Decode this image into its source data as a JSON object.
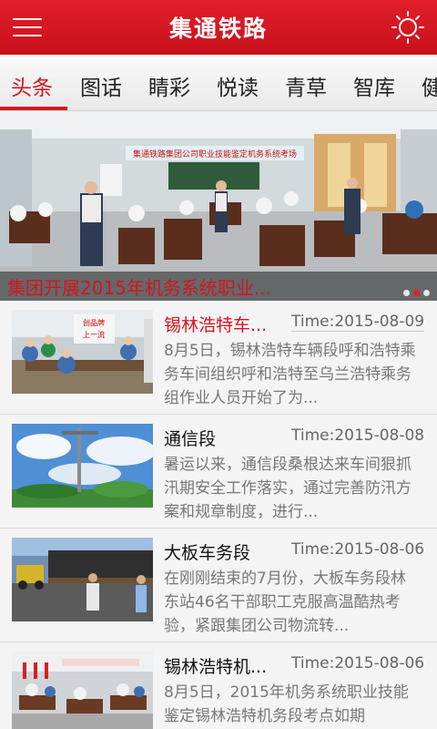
{
  "header": {
    "title": "集通铁路",
    "menu_icon": "hamburger-menu-icon",
    "settings_icon": "sun-settings-icon",
    "accent_color": "#d3151f"
  },
  "tabs": [
    {
      "label": "头条",
      "active": true
    },
    {
      "label": "图话",
      "active": false
    },
    {
      "label": "睛彩",
      "active": false
    },
    {
      "label": "悦读",
      "active": false
    },
    {
      "label": "青草",
      "active": false
    },
    {
      "label": "智库",
      "active": false
    },
    {
      "label": "健",
      "active": false
    }
  ],
  "banner": {
    "title": "集团开展2015年机务系统职业...",
    "photo_banner_text": "集通铁路集团公司职业技能鉴定机务系统考场",
    "slide_count": 3,
    "active_slide": 2
  },
  "news": [
    {
      "title": "锡林浩特车...",
      "time": "Time:2015-08-09",
      "summary": "8月5日，锡林浩特车辆段呼和浩特乘务车间组织呼和浩特至乌兰浩特乘务组作业人员开始了为...",
      "highlight": true,
      "sign_text": "创品牌\n上一流"
    },
    {
      "title": "通信段",
      "time": "Time:2015-08-08",
      "summary": "暑运以来，通信段桑根达来车间狠抓汛期安全工作落实，通过完善防汛方案和规章制度，进行...",
      "highlight": false
    },
    {
      "title": "大板车务段",
      "time": "Time:2015-08-06",
      "summary": "在刚刚结束的7月份，大板车务段林东站46名干部职工克服高温酷热考验，紧跟集团公司物流转...",
      "highlight": false
    },
    {
      "title": "锡林浩特机...",
      "time": "Time:2015-08-06",
      "summary": "8月5日，2015年机务系统职业技能鉴定锡林浩特机务段考点如期",
      "highlight": false
    }
  ]
}
